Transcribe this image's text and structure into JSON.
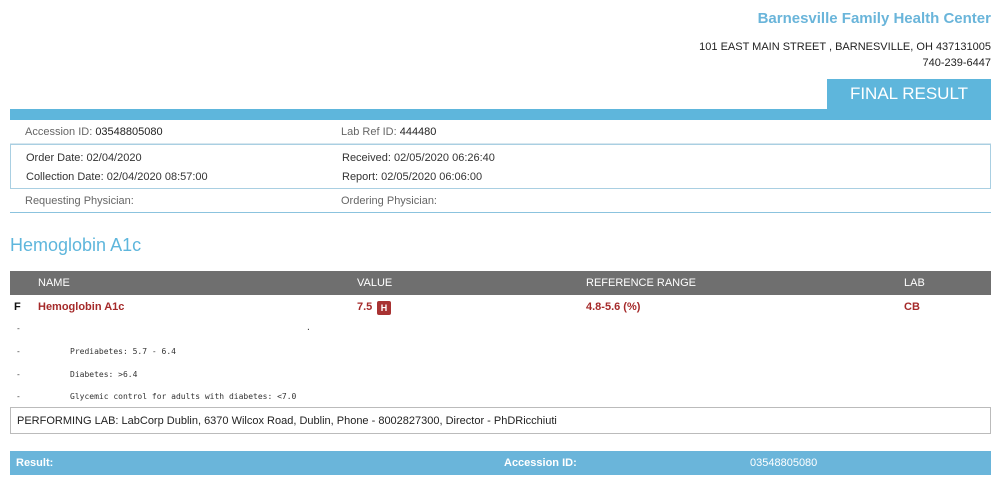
{
  "header": {
    "center_name": "Barnesville Family Health Center",
    "address_line1": "101 EAST MAIN STREET , BARNESVILLE, OH 437131005",
    "phone": "740-239-6447",
    "status": "FINAL RESULT"
  },
  "info": {
    "accession_label": "Accession ID:",
    "accession_value": "03548805080",
    "labref_label": "Lab Ref ID:",
    "labref_value": "444480",
    "order_date_label": "Order Date:",
    "order_date_value": "02/04/2020",
    "received_label": "Received:",
    "received_value": "02/05/2020 06:26:40",
    "collection_label": "Collection Date:",
    "collection_value": "02/04/2020 08:57:00",
    "report_label": "Report:",
    "report_value": "02/05/2020  06:06:00",
    "requesting_label": "Requesting Physician:",
    "requesting_value": "",
    "ordering_label": "Ordering Physician:",
    "ordering_value": ""
  },
  "section_title": "Hemoglobin A1c",
  "table": {
    "columns": [
      "NAME",
      "VALUE",
      "REFERENCE RANGE",
      "LAB"
    ],
    "row": {
      "flag": "F",
      "name": "Hemoglobin A1c",
      "value": "7.5",
      "indicator": "H",
      "reference": "4.8-5.6 (%)",
      "lab": "CB"
    },
    "notes": [
      {
        "dash": "-",
        "text": "",
        "dot": "."
      },
      {
        "dash": "-",
        "text": "Prediabetes: 5.7 - 6.4",
        "dot": ""
      },
      {
        "dash": "-",
        "text": "Diabetes: >6.4",
        "dot": ""
      },
      {
        "dash": "-",
        "text": "Glycemic control for adults with diabetes: <7.0",
        "dot": ""
      }
    ]
  },
  "performing_lab": "PERFORMING LAB: LabCorp Dublin, 6370 Wilcox Road, Dublin, Phone - 8002827300, Director - PhDRicchiuti",
  "footer": {
    "result_label": "Result:",
    "accession_label": "Accession ID:",
    "accession_value": "03548805080"
  },
  "colors": {
    "accent": "#5eb6dc",
    "abnormal": "#a52a2a",
    "header_gray": "#6f6f6f"
  }
}
